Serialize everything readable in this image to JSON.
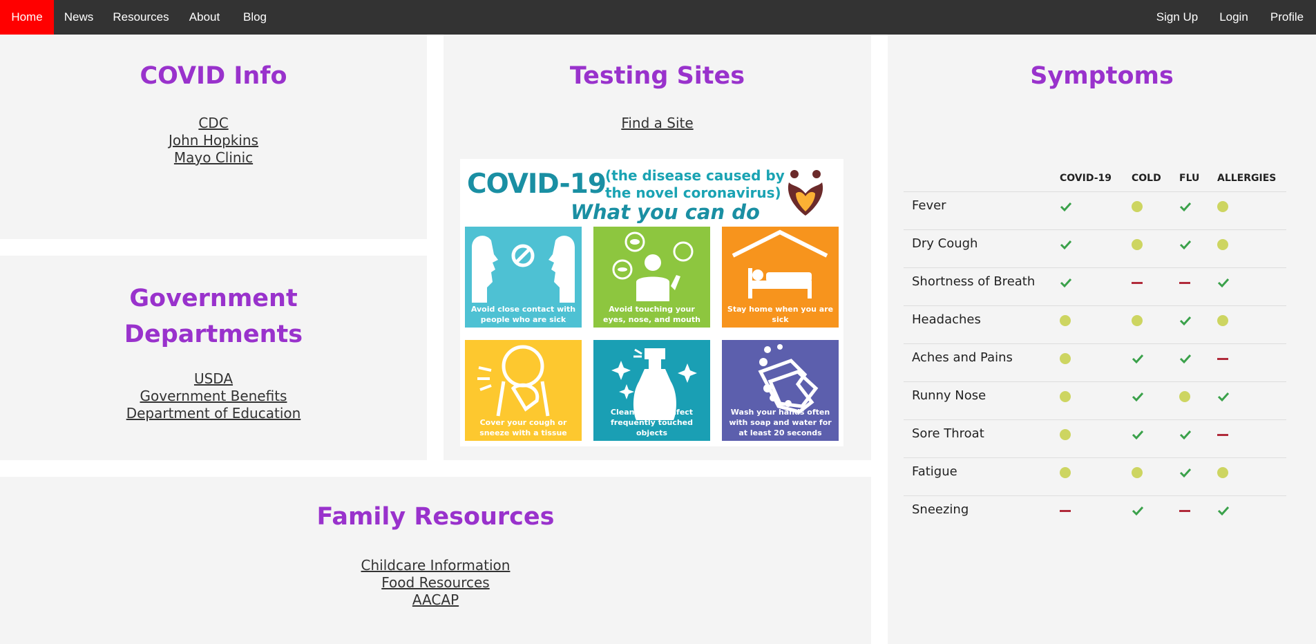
{
  "nav": {
    "left": [
      {
        "label": "Home",
        "active": true
      },
      {
        "label": "News"
      },
      {
        "label": "Resources"
      },
      {
        "label": "About"
      },
      {
        "label": "Blog"
      }
    ],
    "right": [
      {
        "label": "Sign Up"
      },
      {
        "label": "Login"
      },
      {
        "label": "Profile"
      }
    ]
  },
  "covid_info": {
    "title": "COVID Info",
    "links": [
      "CDC",
      "John Hopkins",
      "Mayo Clinic"
    ]
  },
  "testing_sites": {
    "title": "Testing Sites",
    "link": "Find a Site",
    "poster": {
      "headline": "COVID-19",
      "subhead_line1": "(the disease caused by",
      "subhead_line2": "the novel coronavirus)",
      "tagline": "What you can do",
      "tiles": [
        {
          "caption": "Avoid close contact with people who are sick",
          "color": "#4ec1d3",
          "icon": "faces-no-contact-icon"
        },
        {
          "caption": "Avoid touching your eyes, nose, and mouth",
          "color": "#8dc63f",
          "icon": "touch-face-icon"
        },
        {
          "caption": "Stay home when you are sick",
          "color": "#f7941d",
          "icon": "house-bed-icon"
        },
        {
          "caption": "Cover your cough or sneeze with a tissue",
          "color": "#fdc82f",
          "icon": "sneeze-icon"
        },
        {
          "caption": "Clean and disinfect frequently touched objects",
          "color": "#1a9fb4",
          "icon": "spray-bottle-icon"
        },
        {
          "caption": "Wash your hands often with soap and water for at least 20 seconds",
          "color": "#5c5fad",
          "icon": "handwash-icon"
        }
      ]
    }
  },
  "government": {
    "title_line1": "Government",
    "title_line2": "Departments",
    "links": [
      "USDA",
      "Government Benefits",
      "Department of Education"
    ]
  },
  "family": {
    "title": "Family Resources",
    "links": [
      "Childcare Information",
      "Food Resources",
      "AACAP"
    ]
  },
  "symptoms": {
    "title": "Symptoms",
    "columns": [
      "COVID-19",
      "COLD",
      "FLU",
      "ALLERGIES"
    ],
    "legend_colors": {
      "common": "#3aa14a",
      "sometimes": "#cdd561",
      "rare": "#b02a3a"
    },
    "rows": [
      {
        "name": "Fever",
        "values": [
          "common",
          "sometimes",
          "common",
          "sometimes"
        ]
      },
      {
        "name": "Dry Cough",
        "values": [
          "common",
          "sometimes",
          "common",
          "sometimes"
        ]
      },
      {
        "name": "Shortness of Breath",
        "values": [
          "common",
          "rare",
          "rare",
          "common"
        ]
      },
      {
        "name": "Headaches",
        "values": [
          "sometimes",
          "sometimes",
          "common",
          "sometimes"
        ]
      },
      {
        "name": "Aches and Pains",
        "values": [
          "sometimes",
          "common",
          "common",
          "rare"
        ]
      },
      {
        "name": "Runny Nose",
        "values": [
          "sometimes",
          "common",
          "sometimes",
          "common"
        ]
      },
      {
        "name": "Sore Throat",
        "values": [
          "sometimes",
          "common",
          "common",
          "rare"
        ]
      },
      {
        "name": "Fatigue",
        "values": [
          "sometimes",
          "sometimes",
          "common",
          "sometimes"
        ]
      },
      {
        "name": "Sneezing",
        "values": [
          "rare",
          "common",
          "rare",
          "common"
        ]
      }
    ]
  }
}
